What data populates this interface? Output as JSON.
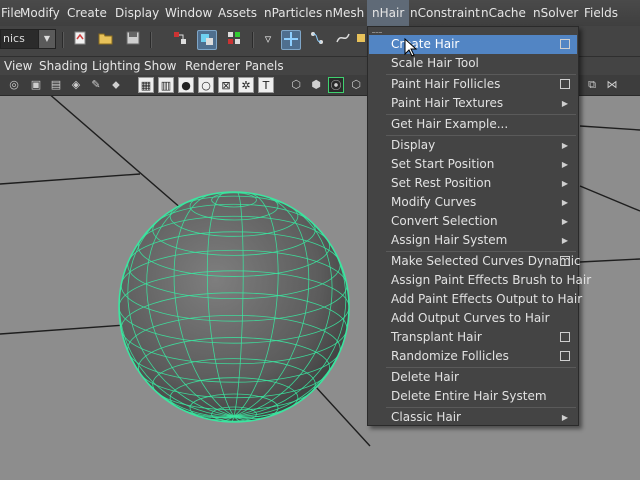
{
  "menubar": {
    "items": [
      "File",
      "Modify",
      "Create",
      "Display",
      "Window",
      "Assets",
      "nParticles",
      "nMesh",
      "nHair",
      "nConstraint",
      "nCache",
      "nSolver",
      "Fields"
    ],
    "active": "nHair"
  },
  "shelf": {
    "mode_value": "nics"
  },
  "panel_menu": {
    "items": [
      "View",
      "Shading",
      "Lighting",
      "Show",
      "Renderer",
      "Panels"
    ]
  },
  "dropdown": {
    "items": [
      {
        "label": "Create Hair",
        "option": true,
        "selected": true
      },
      {
        "label": "Scale Hair Tool"
      },
      {
        "sep": true
      },
      {
        "label": "Paint Hair Follicles",
        "option": true
      },
      {
        "label": "Paint Hair Textures",
        "submenu": true
      },
      {
        "sep": true
      },
      {
        "label": "Get Hair Example..."
      },
      {
        "sep": true
      },
      {
        "label": "Display",
        "submenu": true
      },
      {
        "label": "Set Start Position",
        "submenu": true
      },
      {
        "label": "Set Rest Position",
        "submenu": true
      },
      {
        "label": "Modify Curves",
        "submenu": true
      },
      {
        "label": "Convert Selection",
        "submenu": true
      },
      {
        "label": "Assign Hair System",
        "submenu": true
      },
      {
        "sep": true
      },
      {
        "label": "Make Selected Curves Dynamic",
        "option": true
      },
      {
        "label": "Assign Paint Effects Brush to Hair"
      },
      {
        "label": "Add Paint Effects Output to Hair"
      },
      {
        "label": "Add Output Curves to Hair"
      },
      {
        "label": "Transplant Hair",
        "option": true
      },
      {
        "label": "Randomize Follicles",
        "option": true
      },
      {
        "sep": true
      },
      {
        "label": "Delete Hair"
      },
      {
        "label": "Delete Entire Hair System"
      },
      {
        "sep": true
      },
      {
        "label": "Classic Hair",
        "submenu": true
      }
    ]
  },
  "colors": {
    "selection": "#5285c4",
    "wireframe": "#3be6a0",
    "viewport_bg": "#8d8d8d"
  }
}
